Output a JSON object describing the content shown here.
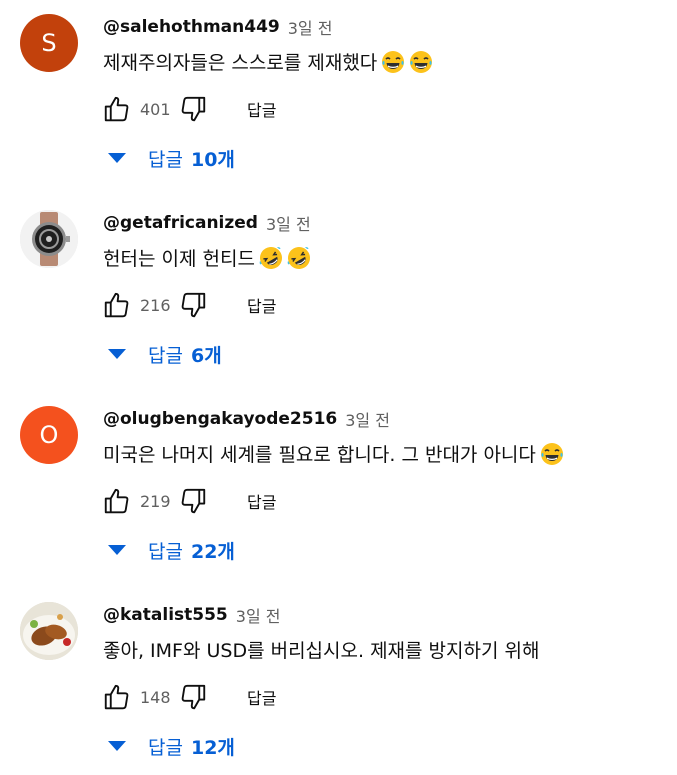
{
  "comments": [
    {
      "avatar_letter": "S",
      "avatar_color": "#c2410c",
      "author": "@salehothman449",
      "time": "3일 전",
      "text": "제재주의자들은 스스로를 제재했다",
      "emojis": [
        "laughing-tears-emoji",
        "laughing-tears-emoji"
      ],
      "likes": "401",
      "reply_label": "답글",
      "replies_label": "답글",
      "replies_count": "10개"
    },
    {
      "avatar_letter": "",
      "avatar_color": "#e6e6e6",
      "author": "@getafricanized",
      "time": "3일 전",
      "text": "헌터는 이제 헌티드",
      "emojis": [
        "rofl-emoji",
        "rofl-emoji"
      ],
      "likes": "216",
      "reply_label": "답글",
      "replies_label": "답글",
      "replies_count": "6개"
    },
    {
      "avatar_letter": "O",
      "avatar_color": "#f4511e",
      "author": "@olugbengakayode2516",
      "time": "3일 전",
      "text": "미국은 나머지 세계를 필요로 합니다. 그 반대가 아니다",
      "emojis": [
        "laughing-tears-emoji"
      ],
      "likes": "219",
      "reply_label": "답글",
      "replies_label": "답글",
      "replies_count": "22개"
    },
    {
      "avatar_letter": "",
      "avatar_color": "#dcd6c8",
      "author": "@katalist555",
      "time": "3일 전",
      "text": "좋아, IMF와 USD를 버리십시오. 제재를 방지하기 위해",
      "emojis": [],
      "likes": "148",
      "reply_label": "답글",
      "replies_label": "답글",
      "replies_count": "12개"
    }
  ],
  "colors": {
    "link_blue": "#065fd4",
    "meta_gray": "#606060",
    "text": "#0f0f0f"
  }
}
